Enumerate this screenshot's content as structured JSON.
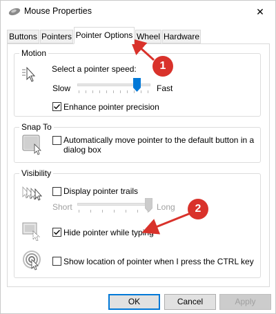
{
  "window": {
    "title": "Mouse Properties",
    "close_glyph": "✕"
  },
  "tabs": [
    {
      "label": "Buttons",
      "active": false
    },
    {
      "label": "Pointers",
      "active": false
    },
    {
      "label": "Pointer Options",
      "active": true
    },
    {
      "label": "Wheel",
      "active": false
    },
    {
      "label": "Hardware",
      "active": false
    }
  ],
  "motion": {
    "group_label": "Motion",
    "speed_label": "Select a pointer speed:",
    "slow_label": "Slow",
    "fast_label": "Fast",
    "speed_level_fraction": 0.82,
    "enhance_label": "Enhance pointer precision",
    "enhance_checked": true
  },
  "snap_to": {
    "group_label": "Snap To",
    "snap_label_line1": "Automatically move pointer to the default button in a",
    "snap_label_line2": "dialog box",
    "snap_checked": false
  },
  "visibility": {
    "group_label": "Visibility",
    "trails_label": "Display pointer trails",
    "trails_checked": false,
    "short_label": "Short",
    "long_label": "Long",
    "trail_length_fraction": 1.0,
    "hide_label": "Hide pointer while typing",
    "hide_checked": true,
    "show_location_label": "Show location of pointer when I press the CTRL key",
    "show_location_checked": false
  },
  "buttons": {
    "ok": "OK",
    "cancel": "Cancel",
    "apply": "Apply"
  },
  "annotations": [
    {
      "number": "1"
    },
    {
      "number": "2"
    }
  ],
  "colors": {
    "accent": "#0078d7",
    "annotation": "#d9322b",
    "disabled_text": "#a0a0a0"
  }
}
